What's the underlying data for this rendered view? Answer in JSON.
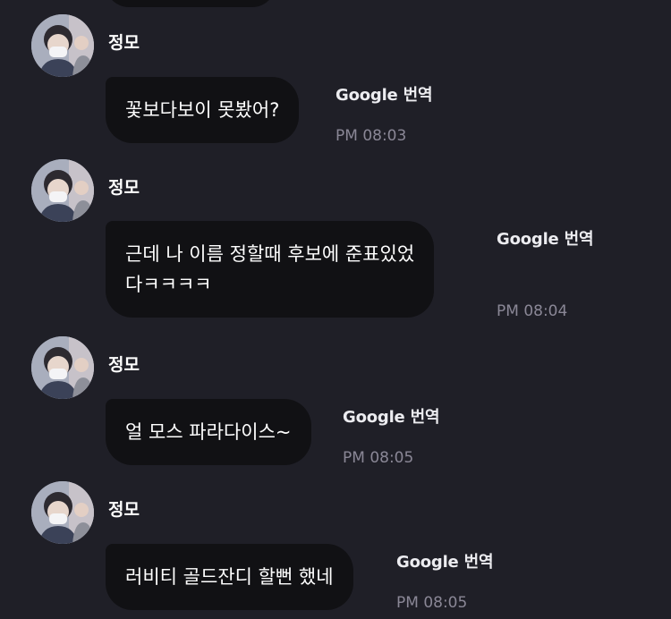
{
  "messages": [
    {
      "sender": "정모",
      "lines": [
        "꽃보다보이 못봤어?"
      ],
      "translate_label": "Google 번역",
      "time": "PM 08:03"
    },
    {
      "sender": "정모",
      "lines": [
        "근데 나 이름 정할때 후보에 준표있었",
        "다ㅋㅋㅋㅋ"
      ],
      "translate_label": "Google 번역",
      "time": "PM 08:04"
    },
    {
      "sender": "정모",
      "lines": [
        "얼 모스 파라다이스~"
      ],
      "translate_label": "Google 번역",
      "time": "PM 08:05"
    },
    {
      "sender": "정모",
      "lines": [
        "러비티 골드잔디 할뻔 했네"
      ],
      "translate_label": "Google 번역",
      "time": "PM 08:05"
    }
  ]
}
